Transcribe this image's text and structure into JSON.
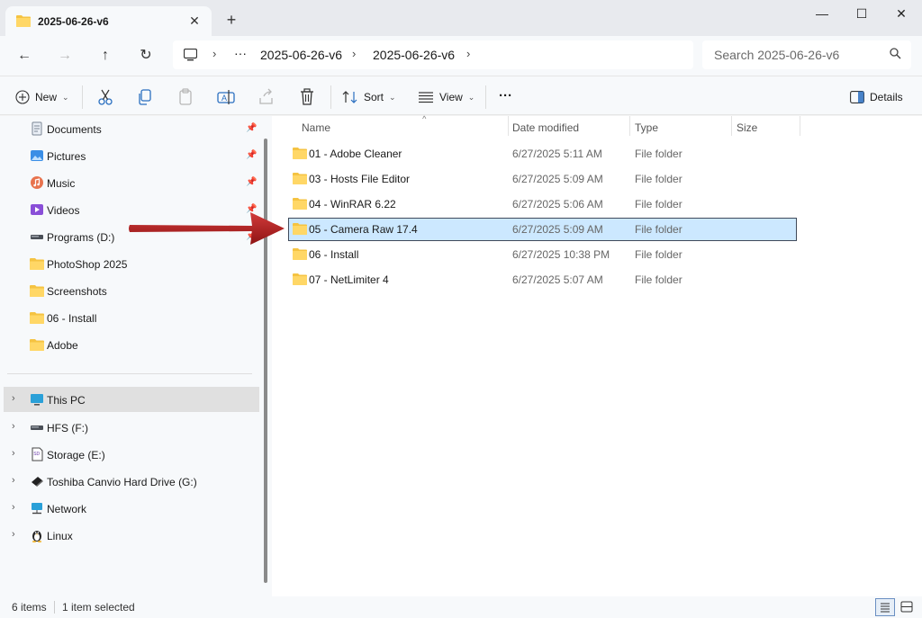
{
  "window": {
    "tab_title": "2025-06-26-v6",
    "tab_close": "✕",
    "new_tab": "+",
    "minimize": "—",
    "maximize": "☐",
    "close": "✕"
  },
  "nav": {
    "back": "←",
    "forward": "→",
    "up": "↑",
    "refresh": "↻"
  },
  "address": {
    "overflow": "···",
    "crumbs": [
      "2025-06-26-v6",
      "2025-06-26-v6"
    ],
    "chevron": "›"
  },
  "search": {
    "placeholder": "Search 2025-06-26-v6"
  },
  "toolbar": {
    "new_label": "New",
    "sort_label": "Sort",
    "view_label": "View",
    "more_label": "···",
    "details_label": "Details",
    "dropdown_caret": "⌄"
  },
  "sidebar": {
    "pinned": [
      {
        "label": "Documents",
        "icon": "documents-icon"
      },
      {
        "label": "Pictures",
        "icon": "pictures-icon"
      },
      {
        "label": "Music",
        "icon": "music-icon"
      },
      {
        "label": "Videos",
        "icon": "videos-icon"
      },
      {
        "label": "Programs (D:)",
        "icon": "drive-icon"
      },
      {
        "label": "PhotoShop 2025",
        "icon": "folder-icon"
      },
      {
        "label": "Screenshots",
        "icon": "folder-icon"
      },
      {
        "label": "06 - Install",
        "icon": "folder-icon"
      },
      {
        "label": "Adobe",
        "icon": "folder-icon"
      }
    ],
    "locations": [
      {
        "label": "This PC",
        "icon": "computer-icon"
      },
      {
        "label": "HFS (F:)",
        "icon": "drive-icon"
      },
      {
        "label": "Storage (E:)",
        "icon": "sd-card-icon"
      },
      {
        "label": "Toshiba Canvio Hard Drive (G:)",
        "icon": "usb-drive-icon"
      },
      {
        "label": "Network",
        "icon": "network-icon"
      },
      {
        "label": "Linux",
        "icon": "linux-icon"
      }
    ],
    "pin_glyph": "📌",
    "expand_glyph": "›"
  },
  "columns": {
    "name": "Name",
    "date": "Date modified",
    "type": "Type",
    "size": "Size",
    "sort_caret": "^"
  },
  "files": [
    {
      "name": "01 - Adobe Cleaner",
      "date": "6/27/2025 5:11 AM",
      "type": "File folder"
    },
    {
      "name": "03 - Hosts File Editor",
      "date": "6/27/2025 5:09 AM",
      "type": "File folder"
    },
    {
      "name": "04 - WinRAR 6.22",
      "date": "6/27/2025 5:06 AM",
      "type": "File folder"
    },
    {
      "name": "05 - Camera Raw 17.4",
      "date": "6/27/2025 5:09 AM",
      "type": "File folder"
    },
    {
      "name": "06 - Install",
      "date": "6/27/2025 10:38 PM",
      "type": "File folder"
    },
    {
      "name": "07 - NetLimiter 4",
      "date": "6/27/2025 5:07 AM",
      "type": "File folder"
    }
  ],
  "status": {
    "items": "6 items",
    "selected": "1 item selected"
  },
  "colors": {
    "accent": "#0067c0",
    "selected_row": "#cce8ff",
    "folder": "#f5c342",
    "arrow": "#b01c1c"
  }
}
